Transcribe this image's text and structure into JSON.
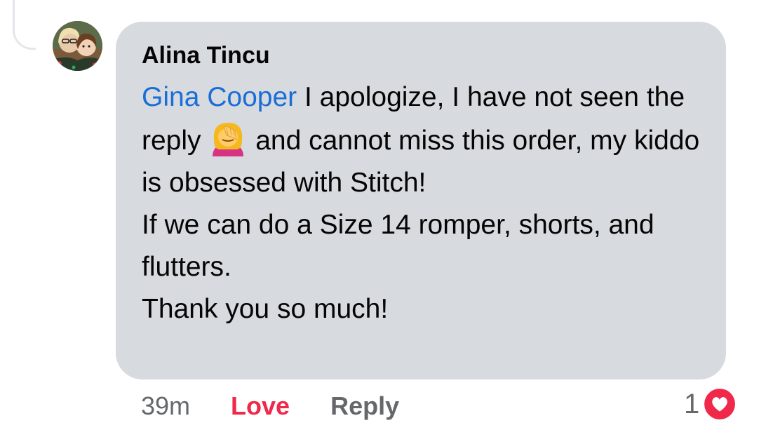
{
  "comment": {
    "author": "Alina Tincu",
    "mention": "Gina Cooper",
    "text_part1": " I apologize,  I have not seen the reply ",
    "emoji": "woman-facepalming-emoji",
    "text_part2": " and cannot miss this order, my kiddo is obsessed with Stitch!",
    "line2": "If we can do a Size 14 romper, shorts, and flutters.",
    "line3": "Thank you so much!"
  },
  "actions": {
    "timestamp": "39m",
    "love_label": "Love",
    "reply_label": "Reply"
  },
  "reactions": {
    "count": "1",
    "type": "love-reaction-icon"
  },
  "colors": {
    "bubble": "#d7dade",
    "mention": "#1a6ed8",
    "love": "#f02849",
    "muted": "#65676b"
  }
}
